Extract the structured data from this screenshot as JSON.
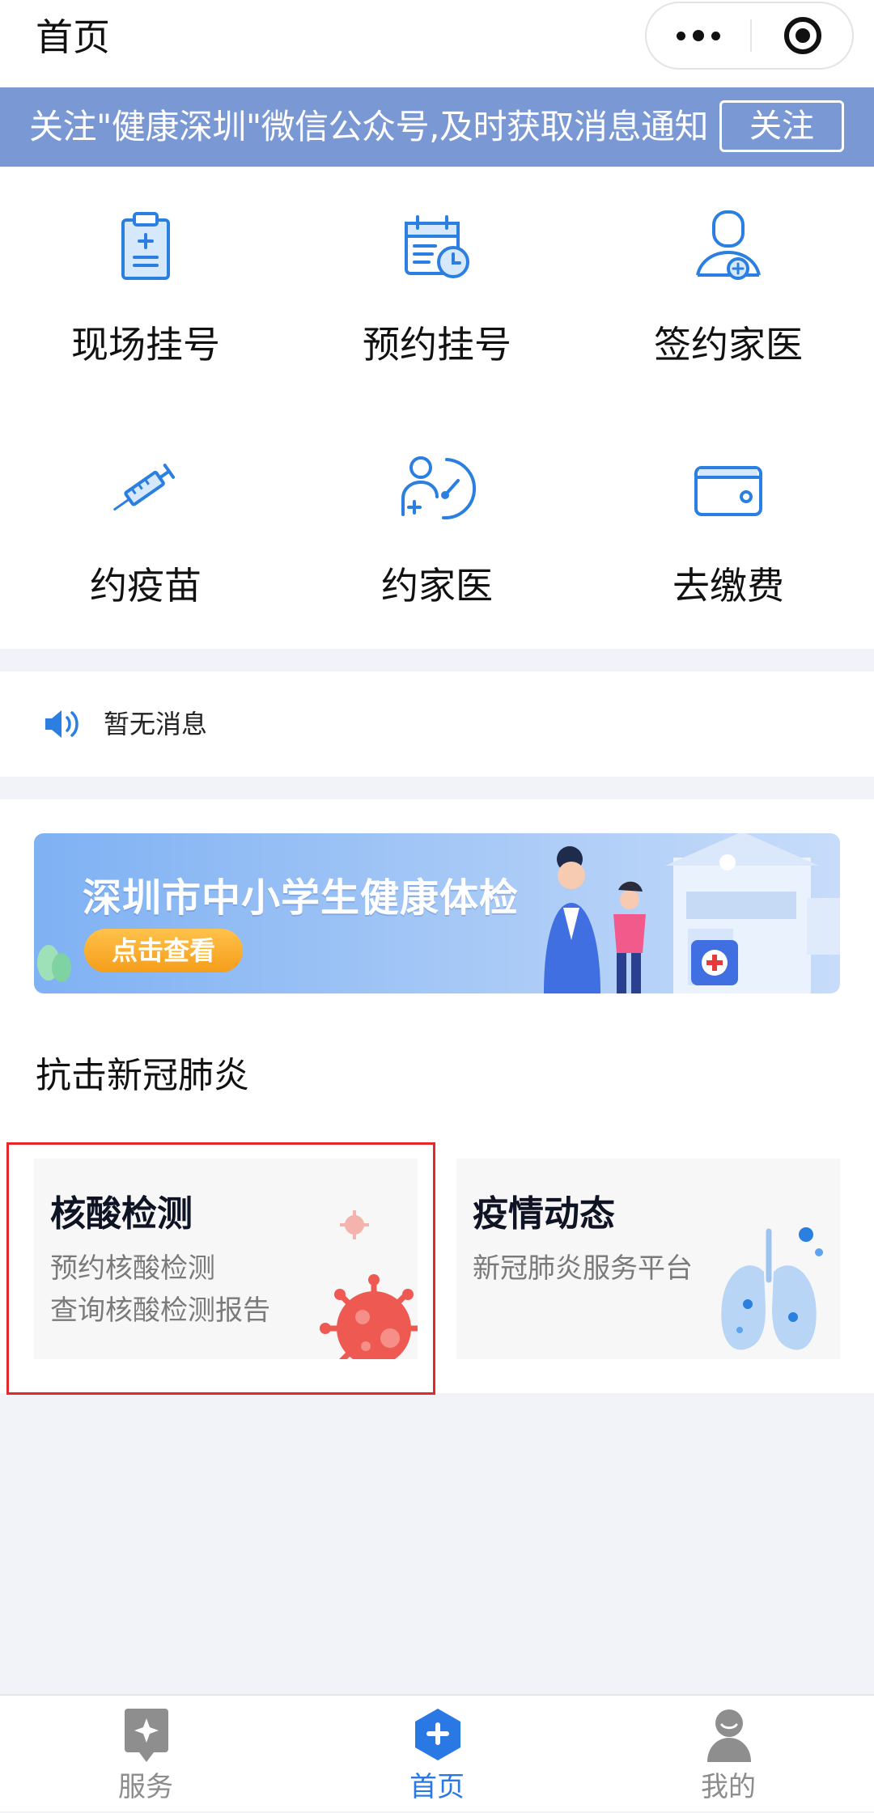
{
  "header": {
    "title": "首页",
    "more_icon": "more-dots-icon",
    "close_icon": "target-close-icon"
  },
  "notice": {
    "text": "关注\"健康深圳\"微信公众号,及时获取消息通知",
    "button": "关注"
  },
  "services": [
    {
      "label": "现场挂号",
      "icon": "clipboard-icon"
    },
    {
      "label": "预约挂号",
      "icon": "calendar-clock-icon"
    },
    {
      "label": "签约家医",
      "icon": "doctor-plus-icon"
    },
    {
      "label": "约疫苗",
      "icon": "syringe-icon"
    },
    {
      "label": "约家医",
      "icon": "person-timer-icon"
    },
    {
      "label": "去缴费",
      "icon": "wallet-icon"
    }
  ],
  "messages": {
    "text": "暂无消息",
    "icon": "speaker-icon"
  },
  "banner": {
    "title": "深圳市中小学生健康体检",
    "button": "点击查看"
  },
  "section": {
    "title": "抗击新冠肺炎"
  },
  "tiles": [
    {
      "title": "核酸检测",
      "lines": [
        "预约核酸检测",
        "查询核酸检测报告"
      ],
      "icon": "virus-icon"
    },
    {
      "title": "疫情动态",
      "lines": [
        "新冠肺炎服务平台"
      ],
      "icon": "lungs-icon"
    }
  ],
  "tabbar": [
    {
      "label": "服务",
      "icon": "service-star-icon",
      "active": false
    },
    {
      "label": "首页",
      "icon": "home-plus-icon",
      "active": true
    },
    {
      "label": "我的",
      "icon": "user-profile-icon",
      "active": false
    }
  ],
  "colors": {
    "accent": "#2a78e4",
    "notice_bg": "#7a99d4",
    "highlight": "#e5262a"
  }
}
